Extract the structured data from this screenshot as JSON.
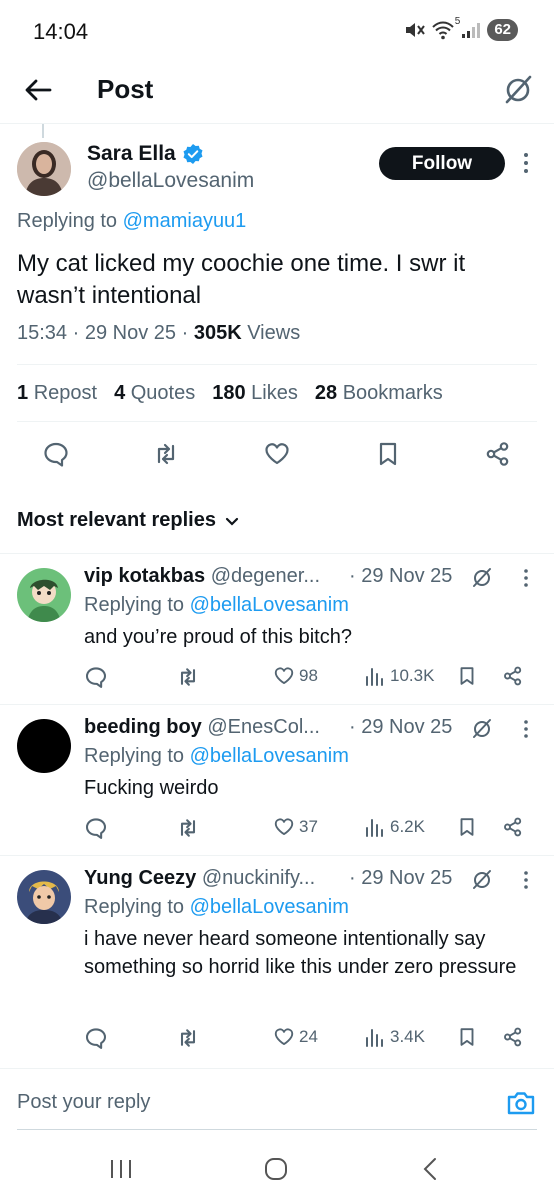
{
  "status_bar": {
    "time": "14:04",
    "battery": "62",
    "wifi_badge": "5"
  },
  "header": {
    "title": "Post"
  },
  "post": {
    "author_name": "Sara Ella",
    "author_handle": "@bellaLovesanim",
    "follow_label": "Follow",
    "replying_prefix": "Replying to",
    "replying_to": "@mamiayuu1",
    "text": "My cat licked my coochie one time. I swr it wasn’t intentional",
    "time": "15:34",
    "date": "29 Nov 25",
    "views_count": "305K",
    "views_label": "Views",
    "stats": {
      "reposts_count": "1",
      "reposts_label": "Repost",
      "quotes_count": "4",
      "quotes_label": "Quotes",
      "likes_count": "180",
      "likes_label": "Likes",
      "bookmarks_count": "28",
      "bookmarks_label": "Bookmarks"
    }
  },
  "replies_filter": "Most relevant replies",
  "replies": [
    {
      "name": "vip kotakbas",
      "handle": "@degener...",
      "date": "· 29 Nov 25",
      "replying_prefix": "Replying to",
      "replying_to": "@bellaLovesanim",
      "text": "and you’re proud of this bitch?",
      "likes": "98",
      "views": "10.3K"
    },
    {
      "name": "beeding boy",
      "handle": "@EnesCol...",
      "date": "· 29 Nov 25",
      "replying_prefix": "Replying to",
      "replying_to": "@bellaLovesanim",
      "text": "Fucking weirdo",
      "likes": "37",
      "views": "6.2K"
    },
    {
      "name": "Yung Ceezy",
      "handle": "@nuckinify...",
      "date": "· 29 Nov 25",
      "replying_prefix": "Replying to",
      "replying_to": "@bellaLovesanim",
      "text": "i have never heard someone intentionally say something so horrid like this under zero pressure",
      "likes": "24",
      "views": "3.4K"
    }
  ],
  "compose": {
    "placeholder": "Post your reply"
  },
  "colors": {
    "accent": "#1d9bf0",
    "text_primary": "#0f1419",
    "text_secondary": "#536471",
    "divider": "#eff3f4",
    "follow_bg": "#0f1419"
  },
  "icons": {
    "back": "arrow-left-icon",
    "grok": "grok-icon",
    "verified": "verified-badge-icon",
    "more": "more-vertical-icon",
    "reply": "reply-icon",
    "repost": "repost-icon",
    "like": "heart-icon",
    "bookmark": "bookmark-icon",
    "share": "share-icon",
    "views": "views-bar-icon",
    "chevron": "chevron-down-icon",
    "camera": "camera-icon"
  }
}
